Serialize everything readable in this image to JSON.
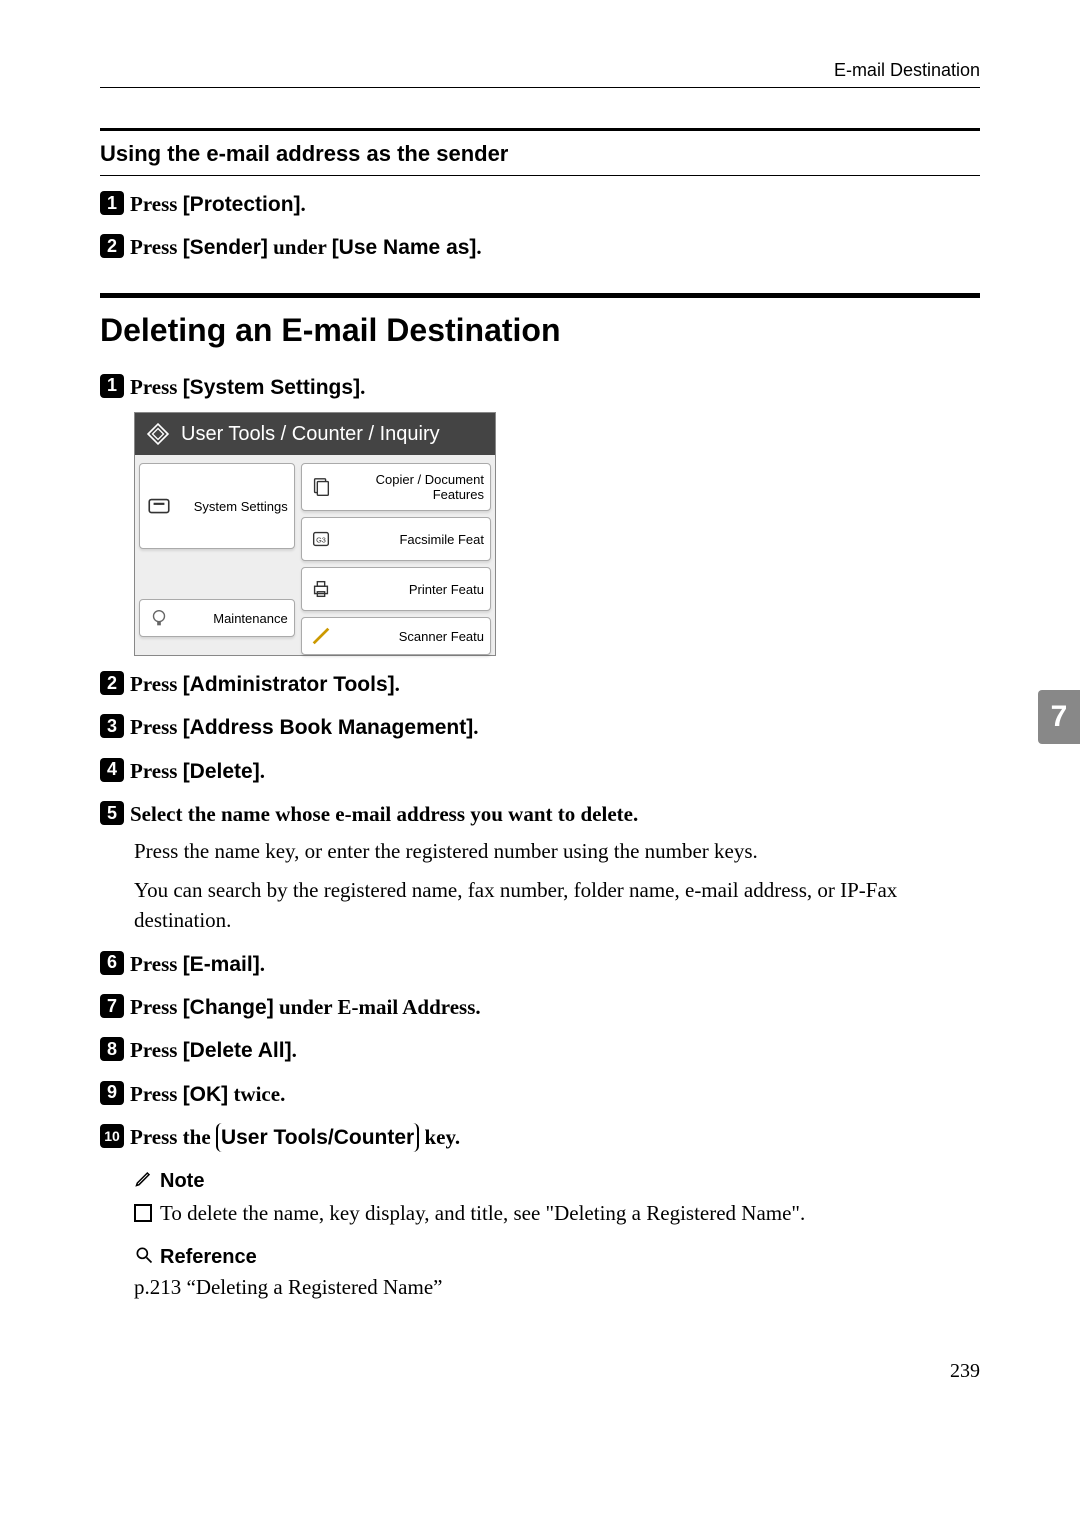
{
  "header": {
    "running": "E-mail Destination"
  },
  "section1": {
    "heading": "Using the e-mail address as the sender",
    "steps": [
      {
        "prefix": "Press ",
        "bold": "[Protection]",
        "suffix": "."
      },
      {
        "prefix": "Press ",
        "bold": "[Sender]",
        "mid": " under ",
        "bold2": "[Use Name as]",
        "suffix": "."
      }
    ]
  },
  "section2": {
    "heading": "Deleting an E-mail Destination",
    "step1": {
      "prefix": "Press ",
      "bold": "[System Settings]",
      "suffix": "."
    },
    "screenshot": {
      "title": "User Tools / Counter / Inquiry",
      "left": {
        "system": "System Settings",
        "maint": "Maintenance"
      },
      "right": {
        "copier": "Copier / Document Features",
        "fax": "Facsimile Feat",
        "printer": "Printer Featu",
        "scanner": "Scanner Featu"
      }
    },
    "step2": {
      "prefix": "Press ",
      "bold": "[Administrator Tools]",
      "suffix": "."
    },
    "step3": {
      "prefix": "Press ",
      "bold": "[Address Book Management]",
      "suffix": "."
    },
    "step4": {
      "prefix": "Press ",
      "bold": "[Delete]",
      "suffix": "."
    },
    "step5": {
      "text": "Select the name whose e-mail address you want to delete."
    },
    "step5a": "Press the name key, or enter the registered number using the number keys.",
    "step5b": "You can search by the registered name, fax number, folder name, e-mail address, or IP-Fax destination.",
    "step6": {
      "prefix": "Press ",
      "bold": "[E-mail]",
      "suffix": "."
    },
    "step7": {
      "prefix": "Press ",
      "bold": "[Change]",
      "mid": " under E-mail Address."
    },
    "step8": {
      "prefix": "Press ",
      "bold": "[Delete All]",
      "suffix": "."
    },
    "step9": {
      "prefix": "Press ",
      "bold": "[OK]",
      "suffix": " twice."
    },
    "step10": {
      "prefix": "Press the ",
      "key": "User Tools/Counter",
      "suffix": " key."
    },
    "note": {
      "head": "Note",
      "body": "To delete the name, key display, and title, see \"Deleting a Registered Name\"."
    },
    "reference": {
      "head": "Reference",
      "body": "p.213 “Deleting a Registered Name”"
    }
  },
  "sidetab": "7",
  "pagenum": "239"
}
